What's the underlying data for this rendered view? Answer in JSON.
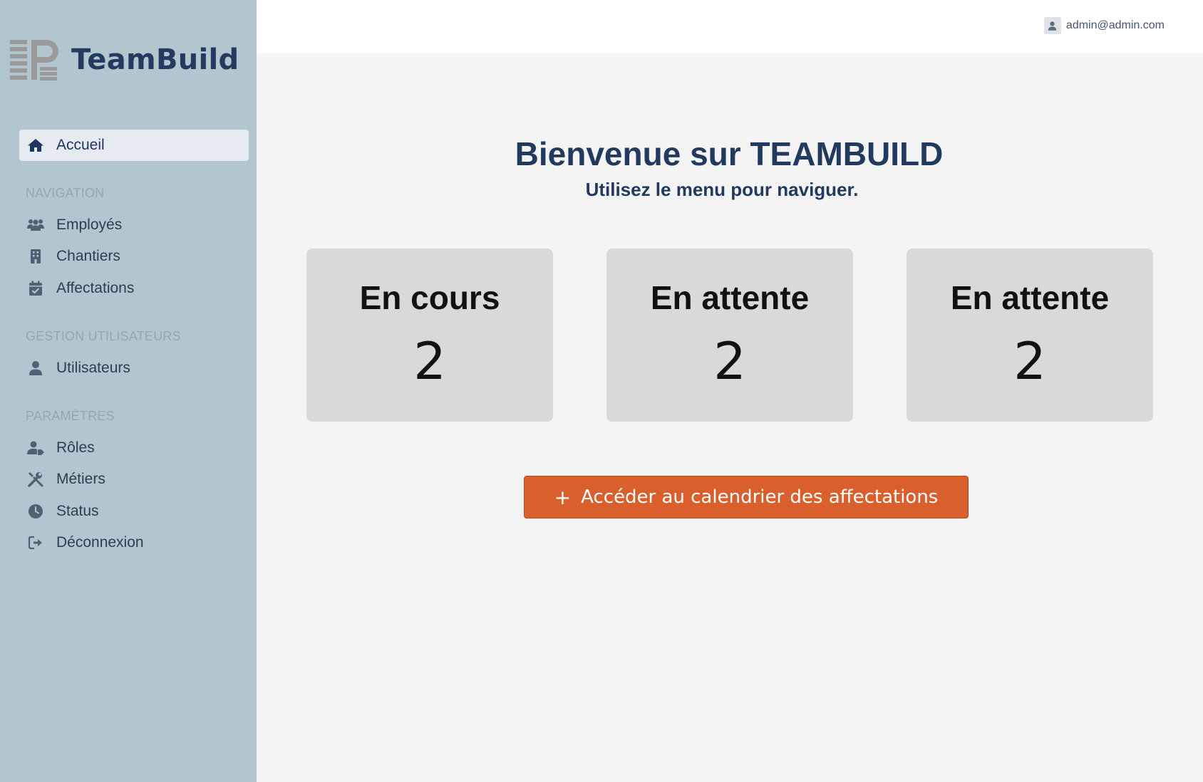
{
  "app": {
    "name": "TeamBuild"
  },
  "user": {
    "email": "admin@admin.com"
  },
  "sidebar": {
    "home": {
      "label": "Accueil",
      "icon": "home-icon"
    },
    "sections": [
      {
        "title": "NAVIGATION",
        "items": [
          {
            "label": "Employés",
            "icon": "users-icon"
          },
          {
            "label": "Chantiers",
            "icon": "building-icon"
          },
          {
            "label": "Affectations",
            "icon": "calendar-check-icon"
          }
        ]
      },
      {
        "title": "GESTION UTILISATEURS",
        "items": [
          {
            "label": "Utilisateurs",
            "icon": "user-icon"
          }
        ]
      },
      {
        "title": "PARAMÈTRES",
        "items": [
          {
            "label": "Rôles",
            "icon": "user-tag-icon"
          },
          {
            "label": "Métiers",
            "icon": "tools-icon"
          },
          {
            "label": "Status",
            "icon": "clock-icon"
          },
          {
            "label": "Déconnexion",
            "icon": "logout-icon"
          }
        ]
      }
    ]
  },
  "main": {
    "title": "Bienvenue sur TEAMBUILD",
    "subtitle": "Utilisez le menu pour naviguer.",
    "cards": [
      {
        "label": "En cours",
        "value": "2"
      },
      {
        "label": "En attente",
        "value": "2"
      },
      {
        "label": "En attente",
        "value": "2"
      }
    ],
    "cta": {
      "icon": "+",
      "label": "Accéder au calendrier des affectations"
    }
  },
  "colors": {
    "sidebar_bg": "#b3c6d0",
    "brand": "#243a5e",
    "accent": "#d9602d",
    "card_bg": "#d9d9d9",
    "main_bg": "#f4f4f4"
  }
}
